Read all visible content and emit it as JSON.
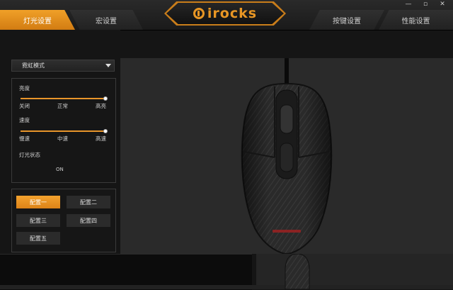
{
  "header": {
    "tabs": [
      {
        "label": "灯光设置",
        "active": true
      },
      {
        "label": "宏设置",
        "active": false
      },
      {
        "label": "按键设置",
        "active": false
      },
      {
        "label": "性能设置",
        "active": false
      }
    ],
    "logo_text": "irocks",
    "window_controls": {
      "minimize": "—",
      "maximize": "▫",
      "close": "✕"
    },
    "accent_color": "#e89624"
  },
  "lighting": {
    "mode_select": "霓虹模式",
    "brightness": {
      "label": "亮度",
      "ticks": [
        "关闭",
        "正常",
        "高亮"
      ],
      "value_fraction": 1.0
    },
    "speed": {
      "label": "速度",
      "ticks": [
        "慢速",
        "中速",
        "高速"
      ],
      "value_fraction": 1.0
    },
    "status": {
      "label": "灯光状态",
      "value": "ON"
    }
  },
  "profiles": [
    {
      "label": "配置一",
      "active": true
    },
    {
      "label": "配置二",
      "active": false
    },
    {
      "label": "配置三",
      "active": false
    },
    {
      "label": "配置四",
      "active": false
    },
    {
      "label": "配置五",
      "active": false
    }
  ]
}
